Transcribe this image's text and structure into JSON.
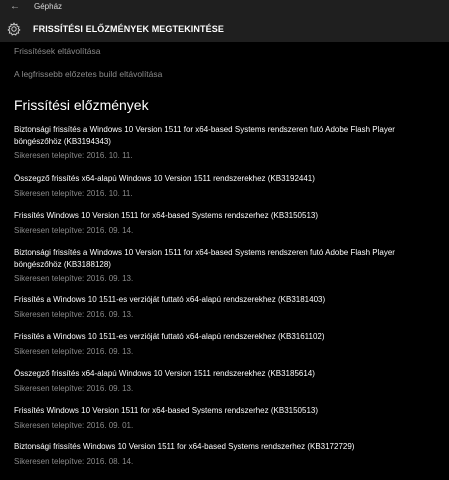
{
  "window": {
    "back_glyph": "←",
    "title": "Gépház"
  },
  "header": {
    "title": "FRISSÍTÉSI ELŐZMÉNYEK MEGTEKINTÉSE"
  },
  "links": {
    "uninstall_updates": "Frissítések eltávolítása",
    "uninstall_build": "A legfrissebb előzetes build eltávolítása"
  },
  "section": {
    "title": "Frissítési előzmények"
  },
  "updates": [
    {
      "name": "Biztonsági frissítés a Windows 10 Version 1511 for x64-based Systems rendszeren futó Adobe Flash Player böngészőhöz (KB3194343)",
      "status": "Sikeresen telepítve: 2016. 10. 11."
    },
    {
      "name": "Összegző frissítés x64-alapú Windows 10 Version 1511 rendszerekhez (KB3192441)",
      "status": "Sikeresen telepítve: 2016. 10. 11."
    },
    {
      "name": "Frissítés Windows 10 Version 1511 for x64-based Systems rendszerhez (KB3150513)",
      "status": "Sikeresen telepítve: 2016. 09. 14."
    },
    {
      "name": "Biztonsági frissítés a Windows 10 Version 1511 for x64-based Systems rendszeren futó Adobe Flash Player böngészőhöz (KB3188128)",
      "status": "Sikeresen telepítve: 2016. 09. 13."
    },
    {
      "name": "Frissítés a Windows 10 1511-es verzióját futtató x64-alapú rendszerekhez (KB3181403)",
      "status": "Sikeresen telepítve: 2016. 09. 13."
    },
    {
      "name": "Frissítés a Windows 10 1511-es verzióját futtató x64-alapú rendszerekhez (KB3161102)",
      "status": "Sikeresen telepítve: 2016. 09. 13."
    },
    {
      "name": "Összegző frissítés x64-alapú Windows 10 Version 1511 rendszerekhez (KB3185614)",
      "status": "Sikeresen telepítve: 2016. 09. 13."
    },
    {
      "name": "Frissítés Windows 10 Version 1511 for x64-based Systems rendszerhez (KB3150513)",
      "status": "Sikeresen telepítve: 2016. 09. 01."
    },
    {
      "name": "Biztonsági frissítés Windows 10 Version 1511 for x64-based Systems rendszerhez (KB3172729)",
      "status": "Sikeresen telepítve: 2016. 08. 14."
    }
  ],
  "icons": {
    "back": "back-arrow-icon",
    "settings": "gear-icon"
  },
  "colors": {
    "background": "#000000",
    "chrome": "#1f1f1f",
    "text": "#ffffff",
    "muted": "#8a8a8a"
  }
}
